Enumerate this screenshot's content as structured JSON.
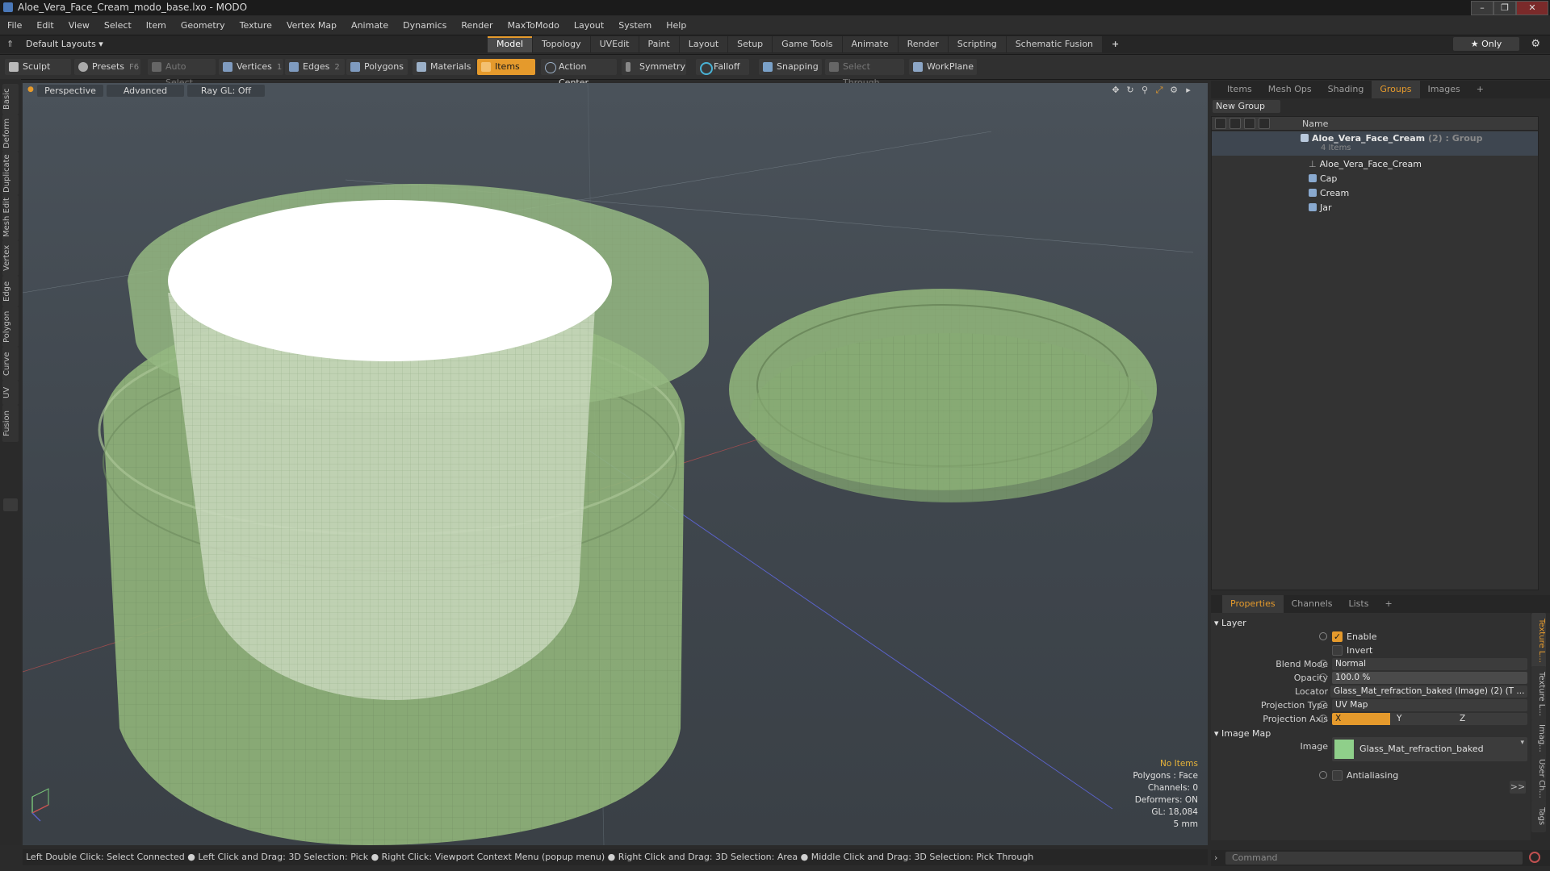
{
  "window": {
    "title": "Aloe_Vera_Face_Cream_modo_base.lxo - MODO",
    "controls": [
      "–",
      "❐",
      "✕"
    ]
  },
  "menu": [
    "File",
    "Edit",
    "View",
    "Select",
    "Item",
    "Geometry",
    "Texture",
    "Vertex Map",
    "Animate",
    "Dynamics",
    "Render",
    "MaxToModo",
    "Layout",
    "System",
    "Help"
  ],
  "layouts": {
    "preset": "Default Layouts ▾",
    "tabs": [
      "Model",
      "Topology",
      "UVEdit",
      "Paint",
      "Layout",
      "Setup",
      "Game Tools",
      "Animate",
      "Render",
      "Scripting",
      "Schematic Fusion"
    ],
    "active_tab": "Model",
    "add": "+",
    "only": "★  Only"
  },
  "toolbar": {
    "sculpt": "Sculpt",
    "presets": "Presets",
    "presets_key": "F6",
    "auto_select": "Auto Select",
    "vertices": "Vertices",
    "vertices_count": "1",
    "edges": "Edges",
    "edges_count": "2",
    "polygons": "Polygons",
    "materials": "Materials",
    "items": "Items",
    "action_center": "Action Center",
    "symmetry": "Symmetry",
    "falloff": "Falloff",
    "snapping": "Snapping",
    "select_through": "Select Through",
    "workplane": "WorkPlane"
  },
  "left_tabs": [
    "Basic",
    "Deform",
    "Duplicate",
    "Mesh Edit",
    "Vertex",
    "Edge",
    "Polygon",
    "Curve",
    "UV",
    "Fusion"
  ],
  "viewport": {
    "view": "Perspective",
    "shading": "Advanced",
    "raygl": "Ray GL: Off",
    "info": {
      "selection": "No Items",
      "polygons": "Polygons : Face",
      "channels": "Channels: 0",
      "deformers": "Deformers: ON",
      "gl": "GL: 18,084",
      "scale": "5 mm"
    }
  },
  "status": "Left Double Click: Select Connected ● Left Click and Drag: 3D Selection: Pick ● Right Click: Viewport Context Menu (popup menu) ● Right Click and Drag: 3D Selection: Area ● Middle Click and Drag: 3D Selection: Pick Through",
  "groups_panel": {
    "tabs": [
      "Items",
      "Mesh Ops",
      "Shading",
      "Groups",
      "Images",
      "+"
    ],
    "active_tab": "Groups",
    "new_group": "New Group",
    "header_name": "Name",
    "group": {
      "name": "Aloe_Vera_Face_Cream",
      "count": "(2)",
      "type": ": Group",
      "sub": "4 Items"
    },
    "children": [
      "Aloe_Vera_Face_Cream",
      "Cap",
      "Cream",
      "Jar"
    ]
  },
  "properties": {
    "tabs": [
      "Properties",
      "Channels",
      "Lists",
      "+"
    ],
    "active_tab": "Properties",
    "layer_section": "Layer",
    "enable": "Enable",
    "invert": "Invert",
    "blend_mode_label": "Blend Mode",
    "blend_mode": "Normal",
    "opacity_label": "Opacity",
    "opacity": "100.0 %",
    "locator_label": "Locator",
    "locator": "Glass_Mat_refraction_baked (Image) (2) (T ...",
    "projection_type_label": "Projection Type",
    "projection_type": "UV Map",
    "projection_axis_label": "Projection Axis",
    "axes": [
      "X",
      "Y",
      "Z"
    ],
    "image_map_section": "Image Map",
    "image_label": "Image",
    "image": "Glass_Mat_refraction_baked",
    "antialiasing": "Antialiasing",
    "more": ">>"
  },
  "right_side_tabs": [
    "Texture L...",
    "Texture L...",
    "Imag...",
    "User Ch...",
    "Tags"
  ],
  "command_placeholder": "Command",
  "colors": {
    "accent": "#e59a2c",
    "jar": "#8fb27a",
    "cream": "#ffffff",
    "image_swatch": "#8fcf8a"
  }
}
